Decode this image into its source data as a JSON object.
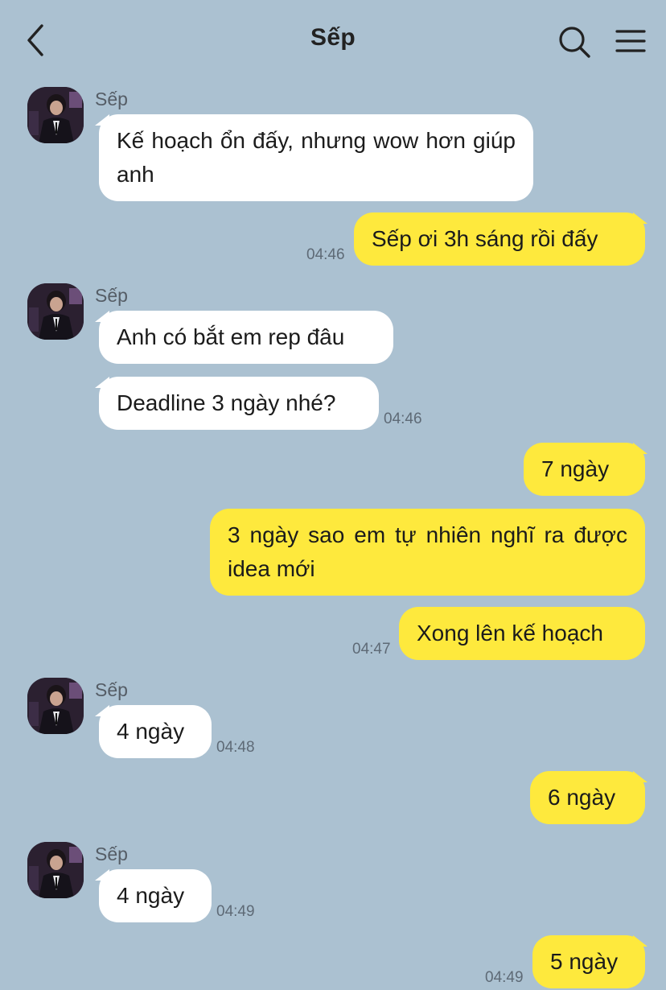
{
  "header": {
    "title": "Sếp",
    "back_icon": "chevron-left-icon",
    "search_icon": "search-icon",
    "menu_icon": "menu-icon"
  },
  "colors": {
    "background": "#abc1d1",
    "incoming_bubble": "#ffffff",
    "outgoing_bubble": "#fee93d"
  },
  "messages": [
    {
      "from": "Sếp",
      "text": "Kế hoạch ổn đấy, nhưng wow hơn giúp anh",
      "time": ""
    },
    {
      "from": "me",
      "text": "Sếp ơi 3h sáng rồi đấy",
      "time": "04:46"
    },
    {
      "from": "Sếp",
      "text": "Anh có bắt em rep đâu",
      "time": ""
    },
    {
      "from": "Sếp",
      "text": "Deadline 3 ngày nhé?",
      "time": "04:46"
    },
    {
      "from": "me",
      "text": "7 ngày",
      "time": ""
    },
    {
      "from": "me",
      "text": "3 ngày sao em tự nhiên nghĩ ra được idea mới",
      "time": ""
    },
    {
      "from": "me",
      "text": "Xong lên kế hoạch",
      "time": "04:47"
    },
    {
      "from": "Sếp",
      "text": "4 ngày",
      "time": "04:48"
    },
    {
      "from": "me",
      "text": "6 ngày",
      "time": ""
    },
    {
      "from": "Sếp",
      "text": "4 ngày",
      "time": "04:49"
    },
    {
      "from": "me",
      "text": "5 ngày",
      "time": "04:49"
    }
  ]
}
